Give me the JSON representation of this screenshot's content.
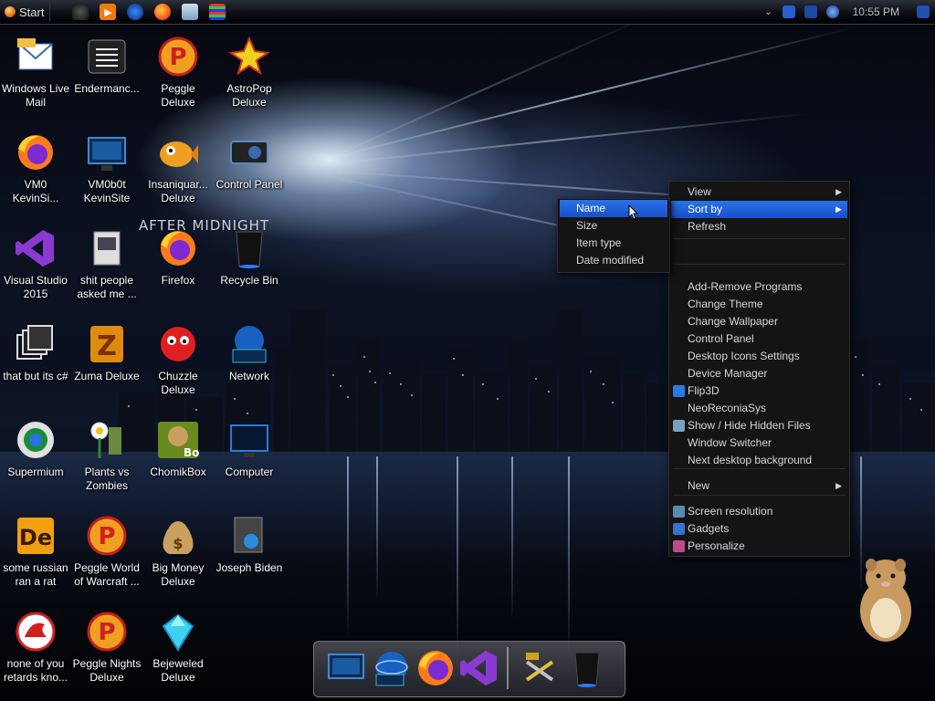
{
  "taskbar": {
    "start_label": "Start",
    "pinned": [
      "media-player-icon",
      "browser-icon",
      "firefox-icon",
      "explorer-icon",
      "app-grid-icon"
    ],
    "clock": "10:55 PM"
  },
  "desktop_icons": [
    {
      "label": "Windows Live Mail",
      "icon": "mail-icon"
    },
    {
      "label": "Endermanc...",
      "icon": "terminal-icon"
    },
    {
      "label": "Peggle Deluxe",
      "icon": "peggle-icon"
    },
    {
      "label": "AstroPop Deluxe",
      "icon": "astropop-icon"
    },
    {
      "label": "VM0 KevinSi...",
      "icon": "firefox-icon"
    },
    {
      "label": "VM0b0t KevinSite",
      "icon": "computer-icon"
    },
    {
      "label": "Insaniquar... Deluxe",
      "icon": "fish-icon"
    },
    {
      "label": "Control Panel",
      "icon": "control-panel-icon"
    },
    {
      "label": "Visual Studio 2015",
      "icon": "visual-studio-icon"
    },
    {
      "label": "shit people asked me ...",
      "icon": "document-icon"
    },
    {
      "label": "Firefox",
      "icon": "firefox-icon"
    },
    {
      "label": "Recycle Bin",
      "icon": "recycle-bin-icon"
    },
    {
      "label": "that but its c#",
      "icon": "windows-stack-icon"
    },
    {
      "label": "Zuma Deluxe",
      "icon": "zuma-icon"
    },
    {
      "label": "Chuzzle Deluxe",
      "icon": "chuzzle-icon"
    },
    {
      "label": "Network",
      "icon": "network-icon"
    },
    {
      "label": "Supermium",
      "icon": "supermium-icon"
    },
    {
      "label": "Plants vs Zombies",
      "icon": "pvz-icon"
    },
    {
      "label": "ChomikBox",
      "icon": "chomikbox-icon"
    },
    {
      "label": "Computer",
      "icon": "monitor-icon"
    },
    {
      "label": "some russian ran a rat",
      "icon": "de-icon"
    },
    {
      "label": "Peggle World of Warcraft ...",
      "icon": "peggle-icon"
    },
    {
      "label": "Big Money Deluxe",
      "icon": "money-bag-icon"
    },
    {
      "label": "Joseph Biden",
      "icon": "user-icon"
    },
    {
      "label": "none of you retards kno...",
      "icon": "dragon-icon"
    },
    {
      "label": "Peggle Nights Deluxe",
      "icon": "peggle-icon"
    },
    {
      "label": "Bejeweled Deluxe",
      "icon": "gem-icon"
    }
  ],
  "context_menu": {
    "items": [
      {
        "label": "View",
        "submenu": true
      },
      {
        "label": "Sort by",
        "submenu": true,
        "highlighted": true
      },
      {
        "label": "Refresh"
      },
      {
        "label": "Add-Remove Programs"
      },
      {
        "label": "Change Theme"
      },
      {
        "label": "Change Wallpaper"
      },
      {
        "label": "Control Panel"
      },
      {
        "label": "Desktop Icons Settings"
      },
      {
        "label": "Device Manager"
      },
      {
        "label": "Flip3D",
        "icon": "flip3d-icon"
      },
      {
        "label": "NeoReconiaSys"
      },
      {
        "label": "Show / Hide Hidden Files",
        "icon": "eye-icon"
      },
      {
        "label": "Window Switcher"
      },
      {
        "label": "Next desktop background"
      },
      {
        "label": "New",
        "submenu": true
      },
      {
        "label": "Screen resolution",
        "icon": "screen-icon"
      },
      {
        "label": "Gadgets",
        "icon": "gadgets-icon"
      },
      {
        "label": "Personalize",
        "icon": "personalize-icon"
      }
    ]
  },
  "sort_submenu": {
    "items": [
      {
        "label": "Name",
        "highlighted": true
      },
      {
        "label": "Size"
      },
      {
        "label": "Item type"
      },
      {
        "label": "Date modified"
      }
    ]
  },
  "wallpaper_text": "AFTER MIDNIGHT",
  "dock": {
    "items": [
      "monitor-icon",
      "network-globe-icon",
      "firefox-icon",
      "visual-studio-icon",
      "tools-icon",
      "recycle-bin-icon"
    ]
  },
  "colors": {
    "highlight": "#1f5fd6",
    "menu_bg": "#141414",
    "taskbar": "#0c0e14"
  }
}
